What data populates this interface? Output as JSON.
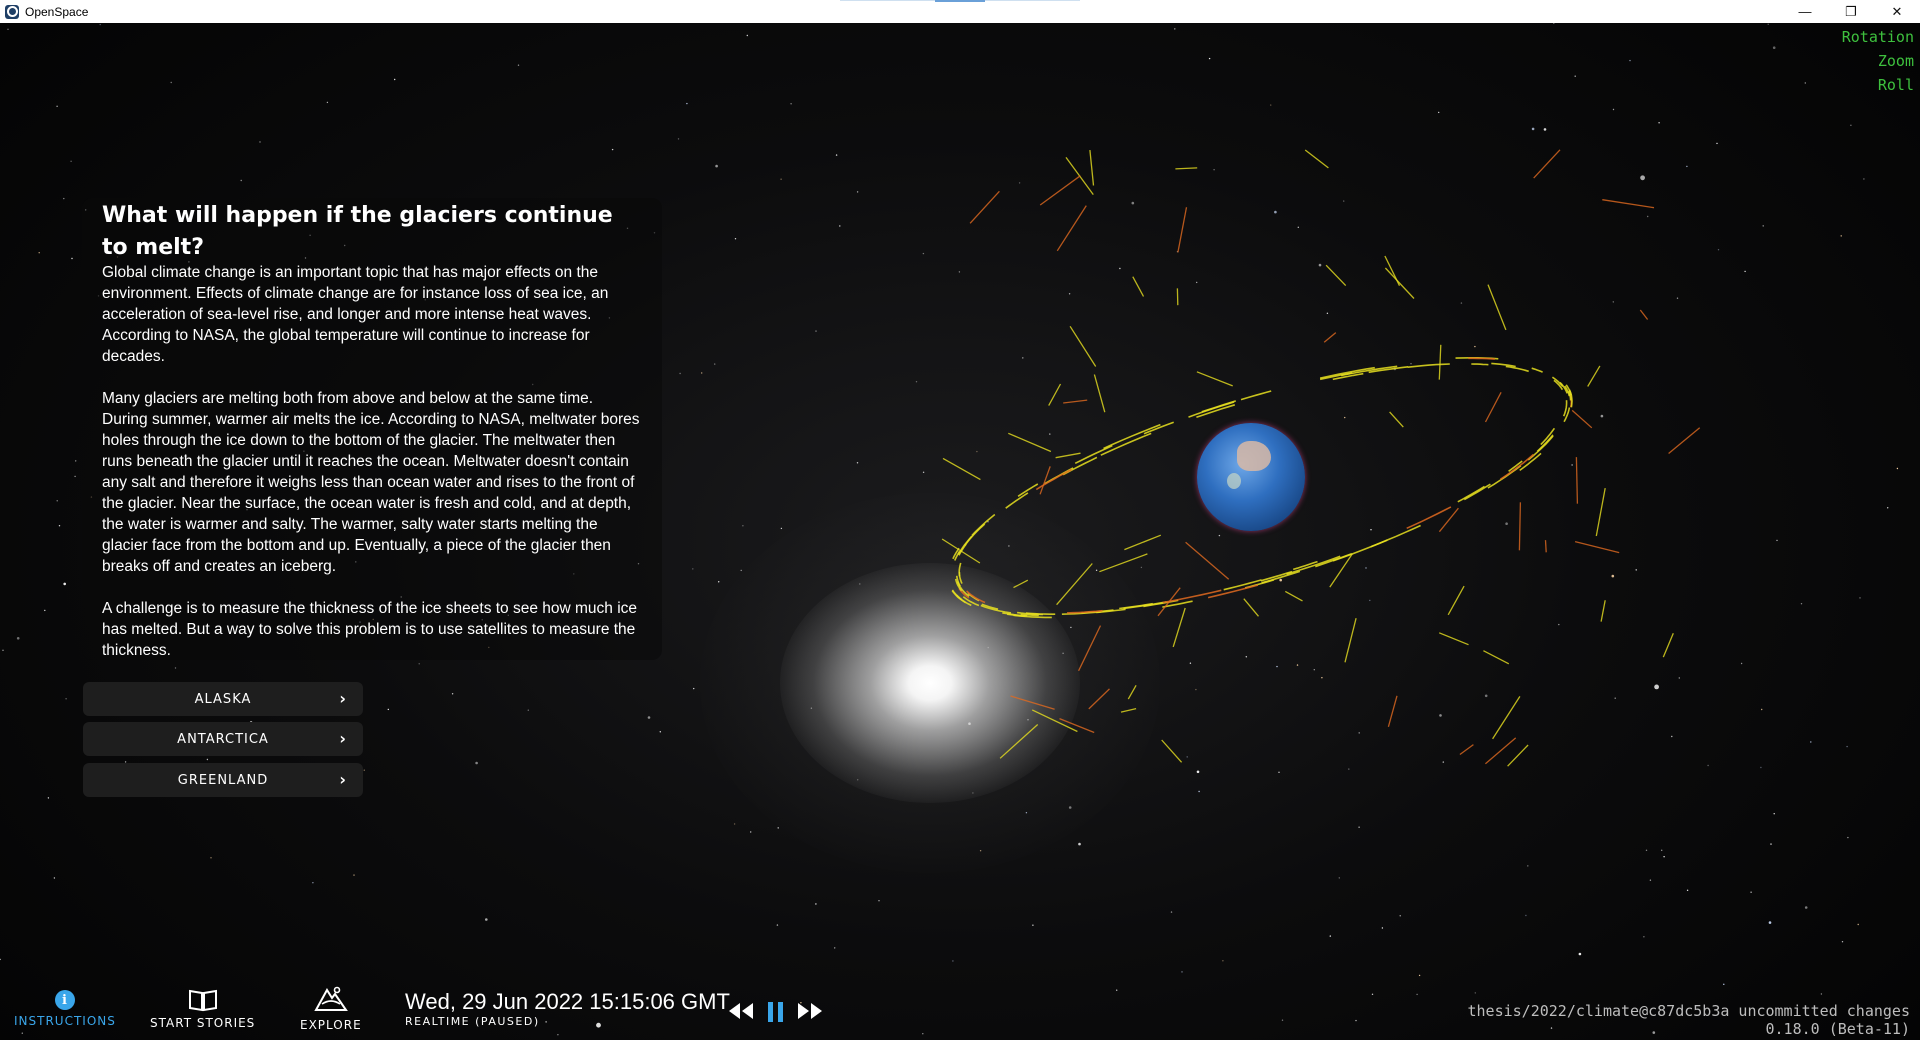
{
  "window": {
    "title": "OpenSpace",
    "controls": {
      "minimize": "—",
      "restore": "❐",
      "close": "✕"
    }
  },
  "navigation_modes": [
    "Rotation",
    "Zoom",
    "Roll"
  ],
  "story": {
    "title": "What will happen if the glaciers continue to melt?",
    "paragraphs": [
      "Global climate change is an important topic that has major effects on the environment. Effects of climate change are for instance loss of sea ice, an acceleration of sea-level rise, and longer and more intense heat waves. According to NASA, the global temperature will continue to increase for decades.",
      "Many glaciers are melting both from above and below at the same time. During summer, warmer air melts the ice. According to NASA, meltwater bores holes through the ice down to the bottom of the glacier. The meltwater then runs beneath the glacier until it reaches the ocean. Meltwater doesn't contain any salt and therefore it weighs less than ocean water and rises to the front of the glacier. Near the surface, the ocean water is fresh and cold, and at depth, the water is warmer and salty. The warmer, salty water starts melting the glacier face from the bottom and up. Eventually, a piece of the glacier then breaks off and creates an iceberg.",
      "A challenge is to measure the thickness of the ice sheets to see how much ice has melted. But a way to solve this problem is to use satellites to measure the thickness."
    ]
  },
  "regions": [
    {
      "label": "ALASKA",
      "icon": "chevron-right-icon"
    },
    {
      "label": "ANTARCTICA",
      "icon": "chevron-right-icon"
    },
    {
      "label": "GREENLAND",
      "icon": "chevron-right-icon"
    }
  ],
  "bottom_bar": {
    "instructions": {
      "label": "INSTRUCTIONS",
      "icon": "info-icon",
      "color": "#3aa6ea"
    },
    "start_stories": {
      "label": "START STORIES",
      "icon": "book-icon"
    },
    "explore": {
      "label": "EXPLORE",
      "icon": "mountain-icon"
    },
    "time": {
      "date": "Wed, 29 Jun 2022 15:15:06 GMT",
      "mode": "REALTIME (PAUSED)"
    },
    "controls": {
      "rewind": "rewind-icon",
      "pause": "pause-icon",
      "forward": "fast-forward-icon"
    }
  },
  "version": {
    "branch": "thesis/2022/climate@c87dc5b3a uncommitted changes",
    "number": "0.18.0 (Beta-11)"
  },
  "colors": {
    "nav_mode_text": "#3ec03e",
    "orbit_trails": "#e8e020",
    "orbit_accents": "#e06a20",
    "pause_icon": "#3aa6ea"
  }
}
